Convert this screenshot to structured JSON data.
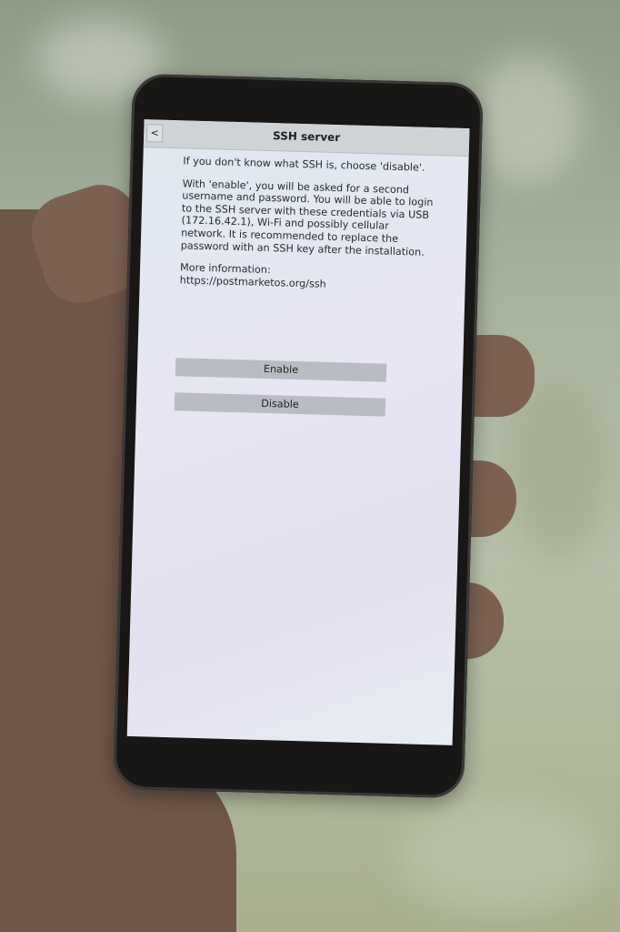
{
  "window": {
    "title": "SSH server",
    "back_label": "<"
  },
  "content": {
    "intro": "If you don't know what SSH is, choose 'disable'.",
    "details": "With 'enable', you will be asked for a second username and password. You will be able to login to the SSH server with these credentials via USB (172.16.42.1), Wi-Fi and possibly cellular network. It is recommended to replace the password with an SSH key after the installation.",
    "more_info_label": "More information:",
    "more_info_url": "https://postmarketos.org/ssh"
  },
  "buttons": {
    "enable": "Enable",
    "disable": "Disable"
  },
  "colors": {
    "titlebar": "#cfd3d6",
    "button": "#b9bcc2",
    "screen_bg": "#e4e6f1"
  }
}
